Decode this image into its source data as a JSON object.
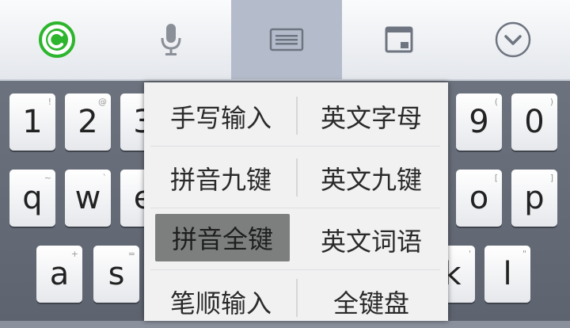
{
  "toolbar": {
    "icons": [
      "logo-icon",
      "microphone-icon",
      "keyboard-layout-icon",
      "window-icon",
      "collapse-icon"
    ],
    "active_index": 2,
    "accent": "#2db52d"
  },
  "keyboard": {
    "row1": [
      {
        "main": "1",
        "sub": "!"
      },
      {
        "main": "2",
        "sub": "@"
      },
      {
        "main": "3",
        "sub": "#"
      },
      {
        "main": "9",
        "sub": "("
      },
      {
        "main": "0",
        "sub": ")"
      }
    ],
    "row2": [
      {
        "main": "q",
        "sub": "~"
      },
      {
        "main": "w",
        "sub": "`"
      },
      {
        "main": "e",
        "sub": "-"
      },
      {
        "main": "o",
        "sub": "["
      },
      {
        "main": "p",
        "sub": "]"
      }
    ],
    "row3": [
      {
        "main": "a",
        "sub": "+"
      },
      {
        "main": "s",
        "sub": "="
      },
      {
        "main": "k",
        "sub": "'"
      },
      {
        "main": "l",
        "sub": "\""
      }
    ]
  },
  "menu": {
    "items": [
      {
        "label": "手写输入",
        "selected": false
      },
      {
        "label": "英文字母",
        "selected": false
      },
      {
        "label": "拼音九键",
        "selected": false
      },
      {
        "label": "英文九键",
        "selected": false
      },
      {
        "label": "拼音全键",
        "selected": true
      },
      {
        "label": "英文词语",
        "selected": false
      },
      {
        "label": "笔顺输入",
        "selected": false
      },
      {
        "label": "全键盘",
        "selected": false
      }
    ]
  }
}
